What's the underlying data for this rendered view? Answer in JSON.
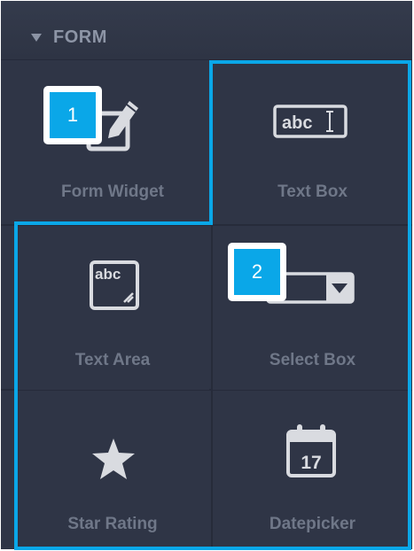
{
  "header": {
    "title": "FORM"
  },
  "tiles": [
    {
      "label": "Form Widget"
    },
    {
      "label": "Text Box"
    },
    {
      "label": "Text Area"
    },
    {
      "label": "Select Box"
    },
    {
      "label": "Star Rating"
    },
    {
      "label": "Datepicker"
    }
  ],
  "icons": {
    "text_box_glyph": "abc",
    "text_area_glyph": "abc",
    "calendar_day": "17"
  },
  "callouts": [
    "1",
    "2"
  ],
  "colors": {
    "panel": "#2f3546",
    "label": "#6f7788",
    "callout": "#0aa7e8",
    "selection": "#0aa7e8"
  }
}
